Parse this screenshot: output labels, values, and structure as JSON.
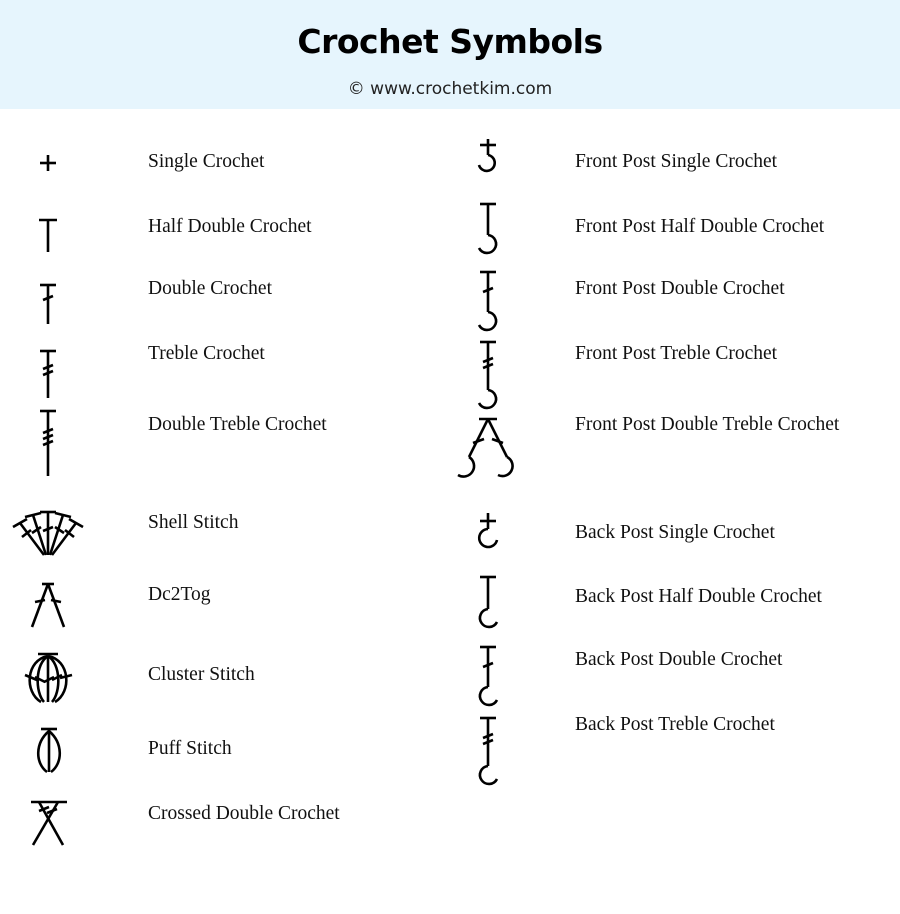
{
  "header": {
    "title": "Crochet Symbols",
    "subtitle": "© www.crochetkim.com",
    "background_color": "#e6f5fd"
  },
  "left_column": [
    {
      "label": "Single Crochet",
      "icon": "single-crochet-icon"
    },
    {
      "label": "Half Double Crochet",
      "icon": "half-double-crochet-icon"
    },
    {
      "label": "Double Crochet",
      "icon": "double-crochet-icon"
    },
    {
      "label": "Treble Crochet",
      "icon": "treble-crochet-icon"
    },
    {
      "label": "Double Treble Crochet",
      "icon": "double-treble-crochet-icon"
    },
    {
      "label": "Shell Stitch",
      "icon": "shell-stitch-icon"
    },
    {
      "label": "Dc2Tog",
      "icon": "dc2tog-icon"
    },
    {
      "label": "Cluster Stitch",
      "icon": "cluster-stitch-icon"
    },
    {
      "label": "Puff Stitch",
      "icon": "puff-stitch-icon"
    },
    {
      "label": "Crossed Double Crochet",
      "icon": "crossed-double-crochet-icon"
    }
  ],
  "right_column": [
    {
      "label": "Front Post Single Crochet",
      "icon": "front-post-single-crochet-icon"
    },
    {
      "label": "Front Post Half Double Crochet",
      "icon": "front-post-half-double-crochet-icon"
    },
    {
      "label": "Front Post Double Crochet",
      "icon": "front-post-double-crochet-icon"
    },
    {
      "label": "Front Post Treble Crochet",
      "icon": "front-post-treble-crochet-icon"
    },
    {
      "label": "Front Post Double Treble Crochet",
      "icon": "front-post-double-treble-crochet-icon"
    },
    {
      "label": "Back Post Single Crochet",
      "icon": "back-post-single-crochet-icon"
    },
    {
      "label": "Back Post Half Double Crochet",
      "icon": "back-post-half-double-crochet-icon"
    },
    {
      "label": "Back Post Double Crochet",
      "icon": "back-post-double-crochet-icon"
    },
    {
      "label": "Back Post Treble Crochet",
      "icon": "back-post-treble-crochet-icon"
    }
  ]
}
